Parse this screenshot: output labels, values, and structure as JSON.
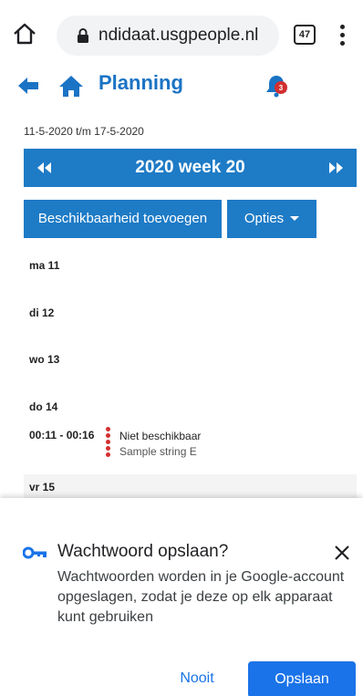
{
  "browser": {
    "url": "ndidaat.usgpeople.nl",
    "tab_count": "47"
  },
  "header": {
    "title": "Planning",
    "notification_count": "3"
  },
  "date_range": "11-5-2020 t/m 17-5-2020",
  "week": {
    "label": "2020 week 20"
  },
  "actions": {
    "add_availability": "Beschikbaarheid toevoegen",
    "options": "Opties"
  },
  "days": [
    {
      "label": "ma 11"
    },
    {
      "label": "di 12"
    },
    {
      "label": "wo 13"
    },
    {
      "label": "do 14"
    },
    {
      "label": "vr 15"
    }
  ],
  "entry": {
    "time": "00:11 - 00:16",
    "status": "Niet beschikbaar",
    "note": "Sample string E"
  },
  "password_prompt": {
    "title": "Wachtwoord opslaan?",
    "body": "Wachtwoorden worden in je Google-account opgeslagen, zodat je deze op elk apparaat kunt gebruiken",
    "never_label": "Nooit",
    "save_label": "Opslaan"
  },
  "colors": {
    "primary": "#1e7bc6",
    "accent_red": "#d32f2f",
    "chrome_blue": "#1a73e8"
  }
}
